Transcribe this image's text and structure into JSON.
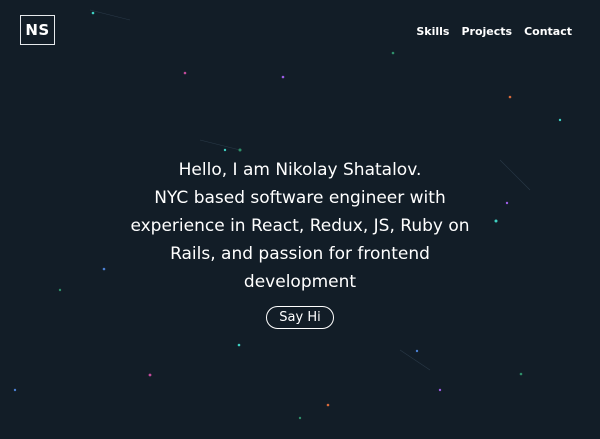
{
  "header": {
    "logo_text": "NS",
    "nav": [
      {
        "label": "Skills"
      },
      {
        "label": "Projects"
      },
      {
        "label": "Contact"
      }
    ]
  },
  "hero": {
    "lines": [
      "Hello, I am Nikolay Shatalov.",
      "NYC based software engineer with",
      "experience in React, Redux, JS, Ruby on",
      "Rails, and passion for frontend",
      "development"
    ],
    "cta_label": "Say Hi"
  },
  "background": {
    "particle_colors": [
      "#3ed0c2",
      "#9b5de5",
      "#2f8f6a",
      "#c24b9a",
      "#4b7fd1",
      "#d96a3a"
    ]
  }
}
